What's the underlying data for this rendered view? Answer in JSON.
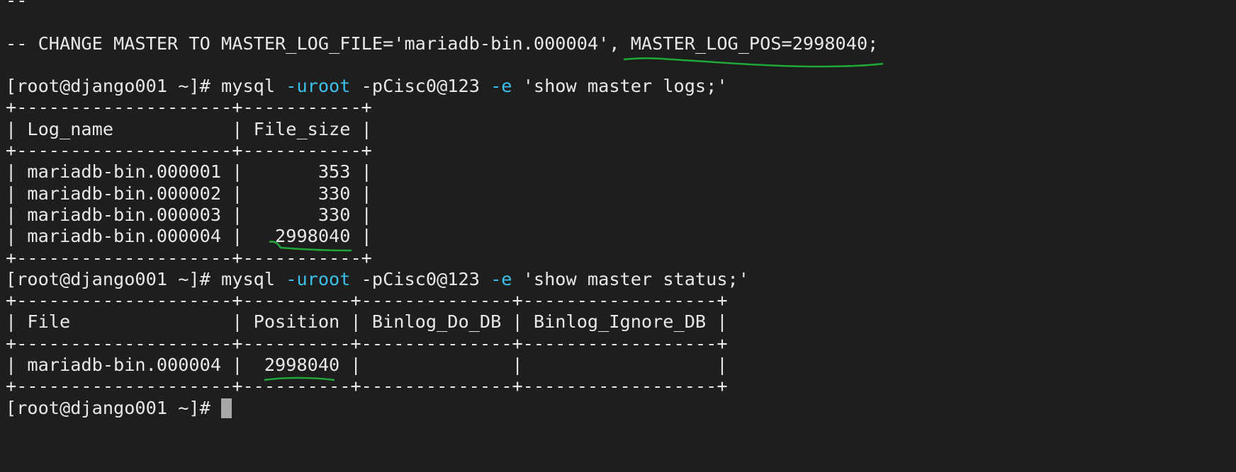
{
  "terminal": {
    "lines": [
      [
        {
          "t": "--"
        }
      ],
      [],
      [
        {
          "t": "-- CHANGE MASTER TO MASTER_LOG_FILE='mariadb-bin.000004', MASTER_LOG_POS=2998040;"
        }
      ],
      [],
      [
        {
          "t": "[root@django001 ~]# mysql "
        },
        {
          "t": "-uroot",
          "c": "blue"
        },
        {
          "t": " -pCisc0@123 "
        },
        {
          "t": "-e",
          "c": "blue"
        },
        {
          "t": " 'show master logs;'"
        }
      ],
      [
        {
          "t": "+--------------------+-----------+"
        }
      ],
      [
        {
          "t": "| Log_name           | File_size |"
        }
      ],
      [
        {
          "t": "+--------------------+-----------+"
        }
      ],
      [
        {
          "t": "| mariadb-bin.000001 |       353 |"
        }
      ],
      [
        {
          "t": "| mariadb-bin.000002 |       330 |"
        }
      ],
      [
        {
          "t": "| mariadb-bin.000003 |       330 |"
        }
      ],
      [
        {
          "t": "| mariadb-bin.000004 |   2998040 |"
        }
      ],
      [
        {
          "t": "+--------------------+-----------+"
        }
      ],
      [
        {
          "t": "[root@django001 ~]# mysql "
        },
        {
          "t": "-uroot",
          "c": "blue"
        },
        {
          "t": " -pCisc0@123 "
        },
        {
          "t": "-e",
          "c": "blue"
        },
        {
          "t": " 'show master status;'"
        }
      ],
      [
        {
          "t": "+--------------------+----------+--------------+------------------+"
        }
      ],
      [
        {
          "t": "| File               | Position | Binlog_Do_DB | Binlog_Ignore_DB |"
        }
      ],
      [
        {
          "t": "+--------------------+----------+--------------+------------------+"
        }
      ],
      [
        {
          "t": "| mariadb-bin.000004 |  2998040 |              |                  |"
        }
      ],
      [
        {
          "t": "+--------------------+----------+--------------+------------------+"
        }
      ],
      [
        {
          "t": "[root@django001 ~]# "
        },
        {
          "cursor": true
        }
      ]
    ]
  },
  "colors": {
    "background": "#1e1e1e",
    "text": "#e8e8e8",
    "option_flag": "#3cc0ea",
    "annotation": "#22a83a",
    "cursor": "#a8a8a8"
  },
  "annotations": [
    "green-underline-master-log-pos",
    "green-underline-file-size-2998040",
    "green-underline-position-2998040"
  ]
}
